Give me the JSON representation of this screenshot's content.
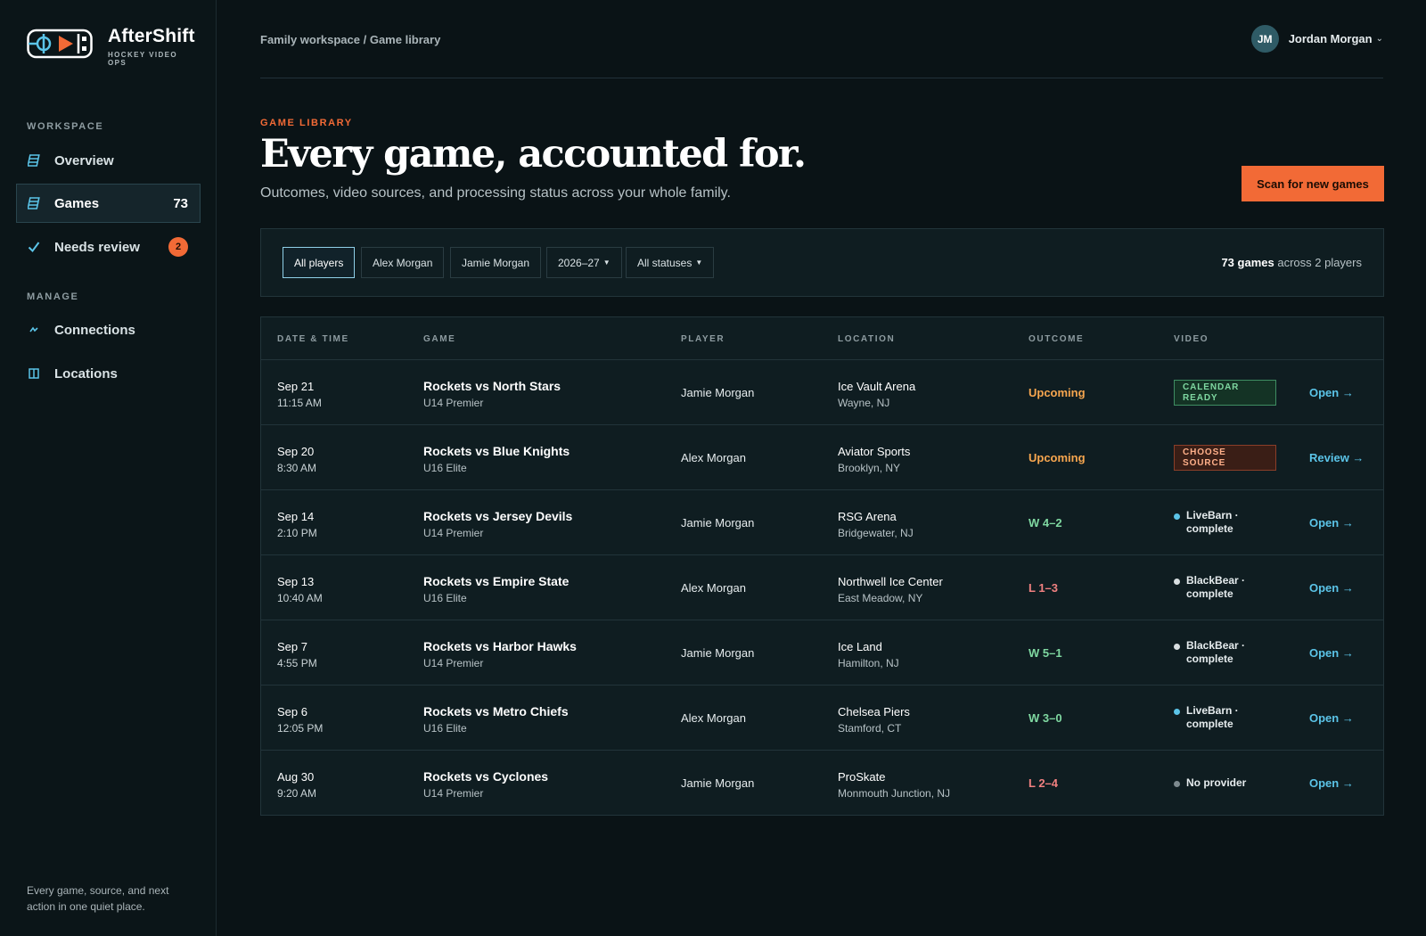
{
  "app": {
    "name": "AfterShift",
    "tagline": "HOCKEY VIDEO OPS"
  },
  "sidebar": {
    "workspace_label": "WORKSPACE",
    "manage_label": "MANAGE",
    "items": [
      {
        "label": "Overview",
        "icon": "calendar-icon"
      },
      {
        "label": "Games",
        "icon": "calendar-icon",
        "count": "73"
      },
      {
        "label": "Needs review",
        "icon": "check-icon",
        "badge": "2"
      },
      {
        "label": "Connections",
        "icon": "link-icon"
      },
      {
        "label": "Locations",
        "icon": "map-icon"
      }
    ],
    "footer": "Every game, source, and next action in one quiet place."
  },
  "topbar": {
    "breadcrumb": "Family workspace / Game library",
    "user": {
      "initials": "JM",
      "name": "Jordan Morgan"
    }
  },
  "header": {
    "eyebrow": "GAME LIBRARY",
    "title": "Every game, accounted for.",
    "subtitle": "Outcomes, video sources, and processing status across your whole family.",
    "scan_button": "Scan for new games"
  },
  "filters": {
    "chips": [
      "All players",
      "Alex Morgan",
      "Jamie Morgan",
      "2026–27",
      "All statuses"
    ],
    "summary_count": "73 games",
    "summary_rest": "across 2 players"
  },
  "table": {
    "headers": [
      "DATE & TIME",
      "GAME",
      "PLAYER",
      "LOCATION",
      "OUTCOME",
      "VIDEO"
    ],
    "rows": [
      {
        "date": "Sep 21",
        "time": "11:15 AM",
        "game": "Rockets vs North Stars",
        "division": "U14 Premier",
        "player": "Jamie Morgan",
        "venue": "Ice Vault Arena",
        "city": "Wayne, NJ",
        "outcome": "Upcoming",
        "video": "CALENDAR READY",
        "action": "Open →"
      },
      {
        "date": "Sep 20",
        "time": "8:30 AM",
        "game": "Rockets vs Blue Knights",
        "division": "U16 Elite",
        "player": "Alex Morgan",
        "venue": "Aviator Sports",
        "city": "Brooklyn, NY",
        "outcome": "Upcoming",
        "video": "CHOOSE SOURCE",
        "action": "Review →"
      },
      {
        "date": "Sep 14",
        "time": "2:10 PM",
        "game": "Rockets vs Jersey Devils",
        "division": "U14 Premier",
        "player": "Jamie Morgan",
        "venue": "RSG Arena",
        "city": "Bridgewater, NJ",
        "outcome": "W 4–2",
        "video": "LiveBarn · complete",
        "action": "Open →"
      },
      {
        "date": "Sep 13",
        "time": "10:40 AM",
        "game": "Rockets vs Empire State",
        "division": "U16 Elite",
        "player": "Alex Morgan",
        "venue": "Northwell Ice Center",
        "city": "East Meadow, NY",
        "outcome": "L 1–3",
        "video": "BlackBear · complete",
        "action": "Open →"
      },
      {
        "date": "Sep 7",
        "time": "4:55 PM",
        "game": "Rockets vs Harbor Hawks",
        "division": "U14 Premier",
        "player": "Jamie Morgan",
        "venue": "Ice Land",
        "city": "Hamilton, NJ",
        "outcome": "W 5–1",
        "video": "BlackBear · complete",
        "action": "Open →"
      },
      {
        "date": "Sep 6",
        "time": "12:05 PM",
        "game": "Rockets vs Metro Chiefs",
        "division": "U16 Elite",
        "player": "Alex Morgan",
        "venue": "Chelsea Piers",
        "city": "Stamford, CT",
        "outcome": "W 3–0",
        "video": "LiveBarn · complete",
        "action": "Open →"
      },
      {
        "date": "Aug 30",
        "time": "9:20 AM",
        "game": "Rockets vs Cyclones",
        "division": "U14 Premier",
        "player": "Jamie Morgan",
        "venue": "ProSkate",
        "city": "Monmouth Junction, NJ",
        "outcome": "L 2–4",
        "video": "No provider",
        "action": "Open →"
      }
    ]
  },
  "colors": {
    "accent": "#f26a36",
    "link": "#5bc4e8",
    "win": "#7fd8a1",
    "loss": "#f08080",
    "upcoming": "#f7a64f",
    "livebarn_dot": "#5bc4e8",
    "blackbear_dot": "#d9dfe1",
    "none_dot": "#7d8a8f"
  }
}
